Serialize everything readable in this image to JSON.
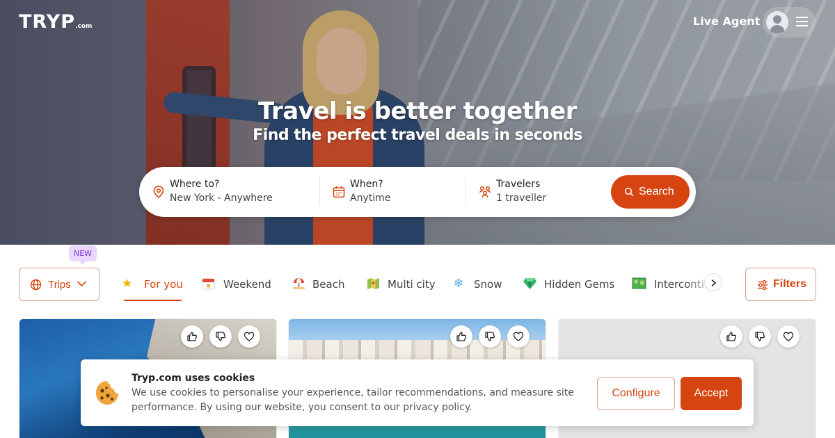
{
  "header": {
    "logo_main": "TRYP",
    "logo_suffix": ".com",
    "live_agent": "Live Agent"
  },
  "hero": {
    "title": "Travel is better together",
    "subtitle": "Find the perfect travel deals in seconds"
  },
  "search": {
    "destination_label": "Where to?",
    "destination_value": "New York - Anywhere",
    "when_label": "When?",
    "when_value": "Anytime",
    "travelers_label": "Travelers",
    "travelers_value": "1 traveller",
    "button": "Search"
  },
  "filters": {
    "new_badge": "NEW",
    "trips_label": "Trips",
    "filters_label": "Filters",
    "tabs": [
      {
        "label": "For you",
        "emoji": "⭐",
        "icon": "star-icon",
        "active": true
      },
      {
        "label": "Weekend",
        "emoji": "📅",
        "icon": "calendar-icon"
      },
      {
        "label": "Beach",
        "emoji": "⛱",
        "icon": "beach-umbrella-icon"
      },
      {
        "label": "Multi city",
        "emoji": "🗺",
        "icon": "map-icon"
      },
      {
        "label": "Snow",
        "emoji": "❄",
        "icon": "snowflake-icon"
      },
      {
        "label": "Hidden Gems",
        "emoji": "💎",
        "icon": "gem-icon"
      },
      {
        "label": "Intercontinental",
        "emoji": "🗾",
        "icon": "world-map-icon"
      }
    ]
  },
  "cookie_banner": {
    "title": "Tryp.com uses cookies",
    "text": "We use cookies to personalise your experience, tailor recommendations, and measure site performance. By using our website, you consent to our privacy policy.",
    "configure": "Configure",
    "accept": "Accept"
  },
  "colors": {
    "accent": "#d64511",
    "badge_bg": "#e9d8fb",
    "badge_text": "#7a3bd0"
  }
}
